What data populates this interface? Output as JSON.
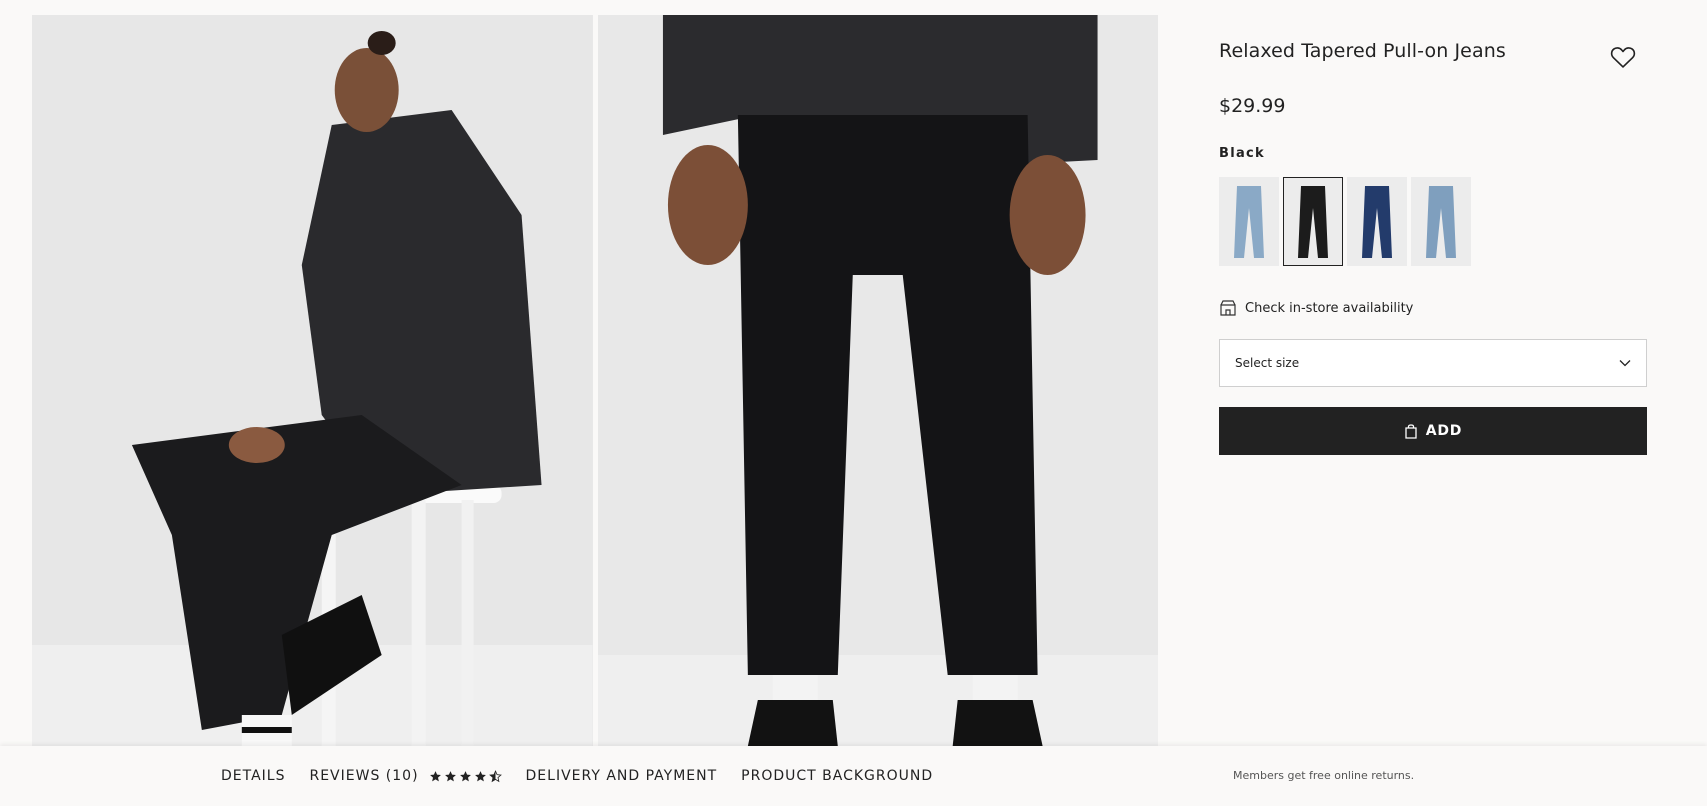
{
  "product": {
    "title": "Relaxed Tapered Pull-on Jeans",
    "price": "$29.99",
    "color_name": "Black",
    "swatches": [
      {
        "name": "light-blue",
        "color": "#8aa9c6"
      },
      {
        "name": "black",
        "color": "#1c1c1c",
        "selected": true
      },
      {
        "name": "dark-blue",
        "color": "#233b6b"
      },
      {
        "name": "blue",
        "color": "#7f9fbe"
      }
    ]
  },
  "store_check": {
    "label": "Check in-store availability",
    "icon": "store-icon"
  },
  "size_select": {
    "placeholder": "Select size",
    "icon": "chevron-down-icon"
  },
  "add_button": {
    "label": "ADD",
    "icon": "shopping-bag-icon"
  },
  "bottom_nav": {
    "tabs": [
      "DETAILS",
      "REVIEWS (10)",
      "DELIVERY AND PAYMENT",
      "PRODUCT BACKGROUND"
    ],
    "rating": 4.5,
    "members_note": "Members get free online returns."
  },
  "colors": {
    "accent": "#222222",
    "background": "#faf9f8",
    "swatch_bg": "#ececec"
  }
}
